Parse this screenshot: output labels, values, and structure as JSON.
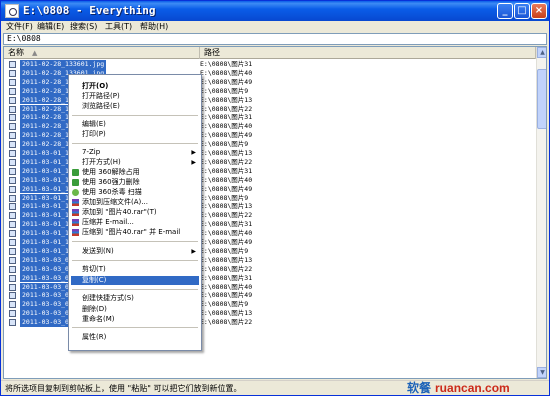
{
  "window": {
    "title": "E:\\0808 - Everything",
    "minimize_glyph": "_",
    "maximize_glyph": "□",
    "close_glyph": "×"
  },
  "menu": [
    {
      "label": "文件(F)"
    },
    {
      "label": "编辑(E)"
    },
    {
      "label": "搜索(S)"
    },
    {
      "label": "工具(T)"
    },
    {
      "label": "帮助(H)"
    }
  ],
  "search": {
    "value": "E:\\0808"
  },
  "columns": {
    "name": "名称",
    "path": "路径",
    "sort_glyph": "▲"
  },
  "rows": [
    {
      "name": "2011-02-28_133601.jpg",
      "path": "E:\\0808\\图片31"
    },
    {
      "name": "2011-02-28_133601.jpg",
      "path": "E:\\0808\\图片40"
    },
    {
      "name": "2011-02-28_133",
      "path": "E:\\0808\\图片49"
    },
    {
      "name": "2011-02-28_133",
      "path": "E:\\0808\\图片9"
    },
    {
      "name": "2011-02-28_171",
      "path": "E:\\0808\\图片13"
    },
    {
      "name": "2011-02-28_171",
      "path": "E:\\0808\\图片22"
    },
    {
      "name": "2011-02-28_171",
      "path": "E:\\0808\\图片31"
    },
    {
      "name": "2011-02-28_171",
      "path": "E:\\0808\\图片40"
    },
    {
      "name": "2011-02-28_171",
      "path": "E:\\0808\\图片49"
    },
    {
      "name": "2011-02-28_171",
      "path": "E:\\0808\\图片9"
    },
    {
      "name": "2011-03-01_135",
      "path": "E:\\0808\\图片13"
    },
    {
      "name": "2011-03-01_135",
      "path": "E:\\0808\\图片22"
    },
    {
      "name": "2011-03-01_135",
      "path": "E:\\0808\\图片31"
    },
    {
      "name": "2011-03-01_135",
      "path": "E:\\0808\\图片40"
    },
    {
      "name": "2011-03-01_135",
      "path": "E:\\0808\\图片49"
    },
    {
      "name": "2011-03-01_135",
      "path": "E:\\0808\\图片9"
    },
    {
      "name": "2011-03-01_141",
      "path": "E:\\0808\\图片13"
    },
    {
      "name": "2011-03-01_141",
      "path": "E:\\0808\\图片22"
    },
    {
      "name": "2011-03-01_141",
      "path": "E:\\0808\\图片31"
    },
    {
      "name": "2011-03-01_141",
      "path": "E:\\0808\\图片40"
    },
    {
      "name": "2011-03-01_141",
      "path": "E:\\0808\\图片49"
    },
    {
      "name": "2011-03-01_141",
      "path": "E:\\0808\\图片9"
    },
    {
      "name": "2011-03-03_095",
      "path": "E:\\0808\\图片13"
    },
    {
      "name": "2011-03-03_095",
      "path": "E:\\0808\\图片22"
    },
    {
      "name": "2011-03-03_095",
      "path": "E:\\0808\\图片31"
    },
    {
      "name": "2011-03-03_095",
      "path": "E:\\0808\\图片40"
    },
    {
      "name": "2011-03-03_095",
      "path": "E:\\0808\\图片49"
    },
    {
      "name": "2011-03-03_095",
      "path": "E:\\0808\\图片9"
    },
    {
      "name": "2011-03-03_095",
      "path": "E:\\0808\\图片13"
    },
    {
      "name": "2011-03-03_095702.jpg",
      "path": "E:\\0808\\图片22"
    }
  ],
  "context_menu": {
    "items": [
      {
        "label": "打开(O)",
        "bold": true
      },
      {
        "label": "打开路径(P)"
      },
      {
        "label": "浏览路径(E)"
      },
      {
        "label": "编辑(E)"
      },
      {
        "label": "打印(P)"
      },
      {
        "label": "7-Zip",
        "arrow": "▶"
      },
      {
        "label": "打开方式(H)",
        "arrow": "▶"
      },
      {
        "label": "使用 360解除占用",
        "icon": "sec"
      },
      {
        "label": "使用 360强力删除",
        "icon": "sec"
      },
      {
        "label": "使用 360杀毒 扫描",
        "icon": "sec2"
      },
      {
        "label": "添加到压缩文件(A)...",
        "icon": "rar"
      },
      {
        "label": "添加到 \"图片40.rar\"(T)",
        "icon": "rar"
      },
      {
        "label": "压缩并 E-mail...",
        "icon": "rar"
      },
      {
        "label": "压缩到 \"图片40.rar\" 并 E-mail",
        "icon": "rar"
      },
      {
        "label": "发送到(N)",
        "arrow": "▶"
      },
      {
        "label": "剪切(T)"
      },
      {
        "label": "复制(C)",
        "highlighted": true
      },
      {
        "label": "创建快捷方式(S)"
      },
      {
        "label": "删除(D)"
      },
      {
        "label": "重命名(M)"
      },
      {
        "label": "属性(R)"
      }
    ]
  },
  "status": {
    "text": "将所选项目复制到剪帖板上，使用 \"粘贴\" 可以把它们放到新位置。"
  },
  "watermark": {
    "cn": "软餐",
    "en": "ruancan.com"
  }
}
